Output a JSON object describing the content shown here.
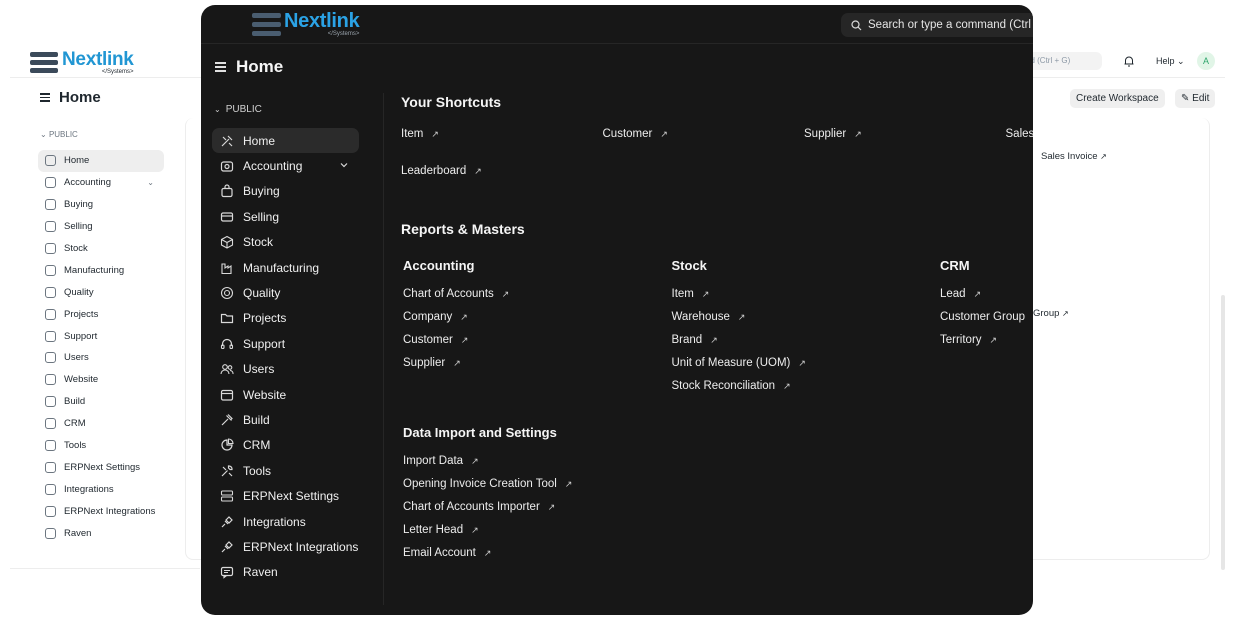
{
  "brand": {
    "name": "Nextlink",
    "tagline": "</Systems>"
  },
  "background": {
    "search_placeholder": "nd (Ctrl + G)",
    "help_label": "Help",
    "avatar_initial": "A",
    "page_title": "Home",
    "create_workspace_label": "Create Workspace",
    "edit_label": "Edit",
    "section_label": "PUBLIC",
    "peek_sales_invoice": "Sales Invoice",
    "peek_group": "Group",
    "nav": [
      {
        "label": "Home"
      },
      {
        "label": "Accounting"
      },
      {
        "label": "Buying"
      },
      {
        "label": "Selling"
      },
      {
        "label": "Stock"
      },
      {
        "label": "Manufacturing"
      },
      {
        "label": "Quality"
      },
      {
        "label": "Projects"
      },
      {
        "label": "Support"
      },
      {
        "label": "Users"
      },
      {
        "label": "Website"
      },
      {
        "label": "Build"
      },
      {
        "label": "CRM"
      },
      {
        "label": "Tools"
      },
      {
        "label": "ERPNext Settings"
      },
      {
        "label": "Integrations"
      },
      {
        "label": "ERPNext Integrations"
      },
      {
        "label": "Raven"
      }
    ]
  },
  "overlay": {
    "search_placeholder": "Search or type a command (Ctrl",
    "page_title": "Home",
    "section_label": "PUBLIC",
    "nav": [
      {
        "label": "Home",
        "icon": "tools-icon"
      },
      {
        "label": "Accounting",
        "icon": "accounting-icon"
      },
      {
        "label": "Buying",
        "icon": "bag-icon"
      },
      {
        "label": "Selling",
        "icon": "card-icon"
      },
      {
        "label": "Stock",
        "icon": "box-icon"
      },
      {
        "label": "Manufacturing",
        "icon": "factory-icon"
      },
      {
        "label": "Quality",
        "icon": "badge-icon"
      },
      {
        "label": "Projects",
        "icon": "folder-icon"
      },
      {
        "label": "Support",
        "icon": "headset-icon"
      },
      {
        "label": "Users",
        "icon": "users-icon"
      },
      {
        "label": "Website",
        "icon": "browser-icon"
      },
      {
        "label": "Build",
        "icon": "hammer-icon"
      },
      {
        "label": "CRM",
        "icon": "chart-pie-icon"
      },
      {
        "label": "Tools",
        "icon": "wrench-icon"
      },
      {
        "label": "ERPNext Settings",
        "icon": "settings-icon"
      },
      {
        "label": "Integrations",
        "icon": "plug-icon"
      },
      {
        "label": "ERPNext Integrations",
        "icon": "plug-icon"
      },
      {
        "label": "Raven",
        "icon": "chat-icon"
      }
    ],
    "shortcuts": {
      "title": "Your Shortcuts",
      "items": [
        "Item",
        "Customer",
        "Supplier",
        "Sales",
        "Leaderboard"
      ]
    },
    "reports": {
      "title": "Reports & Masters",
      "columns": [
        {
          "title": "Accounting",
          "links": [
            "Chart of Accounts",
            "Company",
            "Customer",
            "Supplier"
          ]
        },
        {
          "title": "Stock",
          "links": [
            "Item",
            "Warehouse",
            "Brand",
            "Unit of Measure (UOM)",
            "Stock Reconciliation"
          ]
        },
        {
          "title": "CRM",
          "links": [
            "Lead",
            "Customer Group",
            "Territory"
          ]
        }
      ]
    },
    "data_import": {
      "title": "Data Import and Settings",
      "links": [
        "Import Data",
        "Opening Invoice Creation Tool",
        "Chart of Accounts Importer",
        "Letter Head",
        "Email Account"
      ]
    },
    "link_arrow": "↗"
  }
}
